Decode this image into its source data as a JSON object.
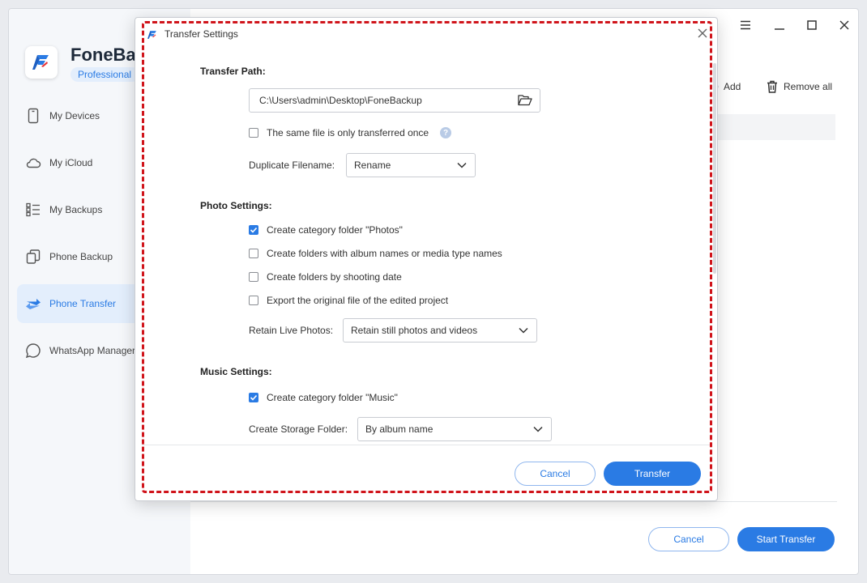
{
  "app": {
    "brand": "FoneBa",
    "edition": "Professional"
  },
  "sidebar": {
    "items": [
      {
        "label": "My Devices",
        "icon": "phone-icon"
      },
      {
        "label": "My iCloud",
        "icon": "cloud-icon"
      },
      {
        "label": "My Backups",
        "icon": "list-icon"
      },
      {
        "label": "Phone Backup",
        "icon": "copy-icon"
      },
      {
        "label": "Phone Transfer",
        "icon": "transfer-icon",
        "active": true
      },
      {
        "label": "WhatsApp Manager",
        "icon": "chat-icon"
      }
    ]
  },
  "main": {
    "add_label": "Add",
    "remove_all_label": "Remove all",
    "cancel_label": "Cancel",
    "start_transfer_label": "Start Transfer"
  },
  "dialog": {
    "title": "Transfer Settings",
    "transfer_path": {
      "heading": "Transfer Path:",
      "path_value": "C:\\Users\\admin\\Desktop\\FoneBackup",
      "same_file_once": {
        "label": "The same file is only transferred once",
        "checked": false
      },
      "duplicate_label": "Duplicate Filename:",
      "duplicate_value": "Rename"
    },
    "photo_settings": {
      "heading": "Photo Settings:",
      "options": [
        {
          "label": "Create category folder \"Photos\"",
          "checked": true
        },
        {
          "label": "Create folders with album names or media type names",
          "checked": false
        },
        {
          "label": "Create folders by shooting date",
          "checked": false
        },
        {
          "label": "Export the original file of the edited project",
          "checked": false
        }
      ],
      "live_photos_label": "Retain Live Photos:",
      "live_photos_value": "Retain still photos and videos"
    },
    "music_settings": {
      "heading": "Music Settings:",
      "category_folder": {
        "label": "Create category folder \"Music\"",
        "checked": true
      },
      "storage_label": "Create Storage Folder:",
      "storage_value": "By album name"
    },
    "cancel_label": "Cancel",
    "transfer_label": "Transfer"
  },
  "colors": {
    "accent": "#2a7be4",
    "highlight": "#d0141b"
  }
}
